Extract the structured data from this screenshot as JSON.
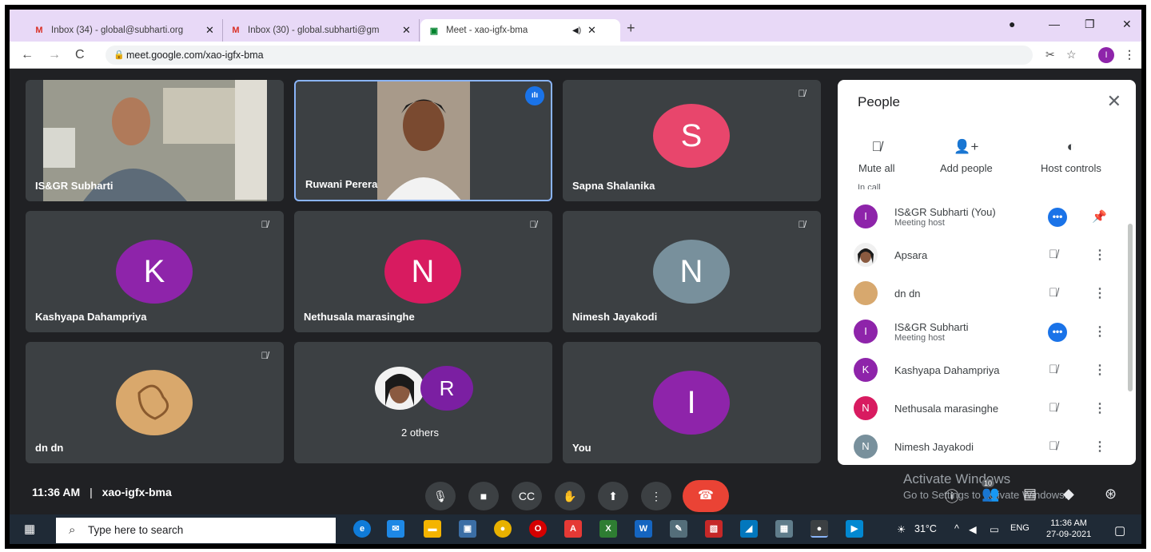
{
  "browser": {
    "tabs": [
      {
        "title": "Inbox (34) - global@subharti.org",
        "icon": "gmail-icon"
      },
      {
        "title": "Inbox (30) - global.subharti@gm",
        "icon": "gmail-icon"
      },
      {
        "title": "Meet - xao-igfx-bma",
        "icon": "meet-icon",
        "active": true
      }
    ],
    "new_tab_label": "+",
    "url": "meet.google.com/xao-igfx-bma",
    "profile_initial": "I"
  },
  "tiles": [
    {
      "name": "IS&GR Subharti",
      "type": "video"
    },
    {
      "name": "Ruwani Perera",
      "type": "video",
      "speaking": true
    },
    {
      "name": "Sapna Shalanika",
      "initial": "S",
      "color": "#e8466c",
      "muted": true
    },
    {
      "name": "Kashyapa Dahampriya",
      "initial": "K",
      "color": "#8e24aa",
      "muted": true
    },
    {
      "name": "Nethusala marasinghe",
      "initial": "N",
      "color": "#d81b60",
      "muted": true
    },
    {
      "name": "Nimesh Jayakodi",
      "initial": "N",
      "color": "#78909c",
      "muted": true
    },
    {
      "name": "dn dn",
      "type": "photo",
      "muted": true
    },
    {
      "name": "2 others",
      "initial": "R",
      "color": "#7b1fa2"
    },
    {
      "name": "You",
      "initial": "I",
      "color": "#8e24aa"
    }
  ],
  "people": {
    "title": "People",
    "actions": {
      "mute_all": "Mute all",
      "add_people": "Add people",
      "host_controls": "Host controls"
    },
    "section": "In call",
    "list": [
      {
        "name": "IS&GR Subharti (You)",
        "sub": "Meeting host",
        "initial": "I",
        "color": "#8e24aa"
      },
      {
        "name": "Apsara",
        "color": "#6d4c41"
      },
      {
        "name": "dn dn",
        "color": "#d7a86e"
      },
      {
        "name": "IS&GR Subharti",
        "sub": "Meeting host",
        "initial": "I",
        "color": "#8e24aa"
      },
      {
        "name": "Kashyapa Dahampriya",
        "initial": "K",
        "color": "#8e24aa"
      },
      {
        "name": "Nethusala marasinghe",
        "initial": "N",
        "color": "#d81b60"
      },
      {
        "name": "Nimesh Jayakodi",
        "initial": "N",
        "color": "#78909c"
      }
    ]
  },
  "bottom": {
    "time": "11:36 AM",
    "separator": "|",
    "code": "xao-igfx-bma",
    "activate_title": "Activate Windows",
    "activate_sub": "Go to Settings to activate Windows.",
    "participants_count": "10"
  },
  "taskbar": {
    "search_placeholder": "Type here to search",
    "temperature": "31°C",
    "language": "ENG",
    "time": "11:36 AM",
    "date": "27-09-2021"
  }
}
